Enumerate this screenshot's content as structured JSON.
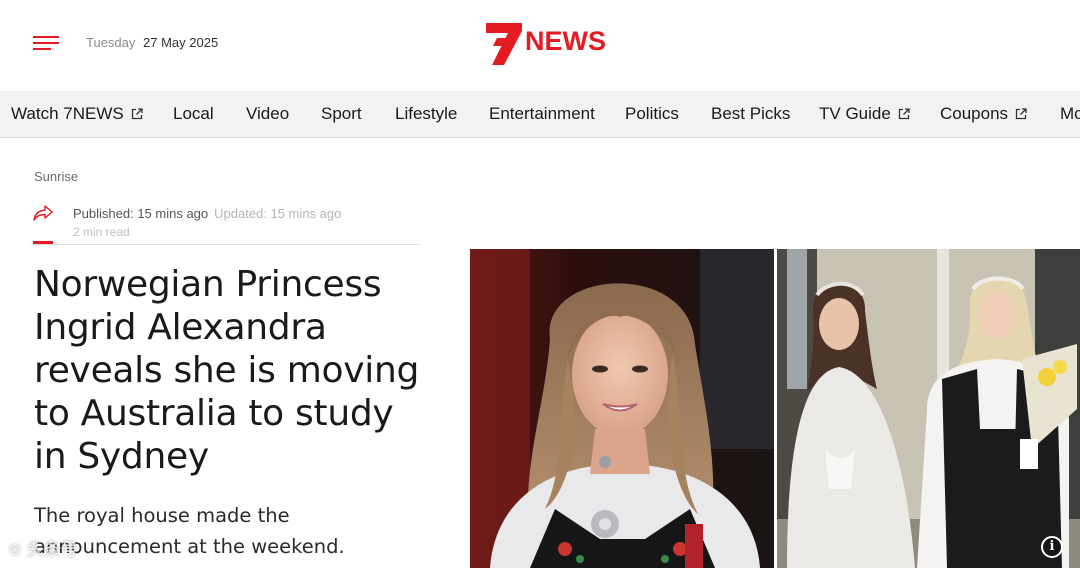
{
  "header": {
    "menu_icon": "hamburger-menu-icon",
    "date_day": "Tuesday",
    "date_full": "27 May 2025",
    "logo_text": "NEWS",
    "brand_color": "#e31b23"
  },
  "nav": {
    "items": [
      {
        "label": "Watch 7NEWS",
        "external": true
      },
      {
        "label": "Local",
        "external": false
      },
      {
        "label": "Video",
        "external": false
      },
      {
        "label": "Sport",
        "external": false
      },
      {
        "label": "Lifestyle",
        "external": false
      },
      {
        "label": "Entertainment",
        "external": false
      },
      {
        "label": "Politics",
        "external": false
      },
      {
        "label": "Best Picks",
        "external": false
      },
      {
        "label": "TV Guide",
        "external": true
      },
      {
        "label": "Coupons",
        "external": true
      },
      {
        "label": "Mo",
        "external": false
      }
    ]
  },
  "article": {
    "category": "Sunrise",
    "published": "Published: 15 mins ago",
    "updated": "Updated: 15 mins ago",
    "read_time": "2 min read",
    "headline": "Norwegian Princess Ingrid Alexandra reveals she is moving to Australia to study in Sydney",
    "standfirst": "The royal house made the announcement at the weekend."
  },
  "media": {
    "info_label": "i"
  },
  "watermark": "⊙ 头条号"
}
